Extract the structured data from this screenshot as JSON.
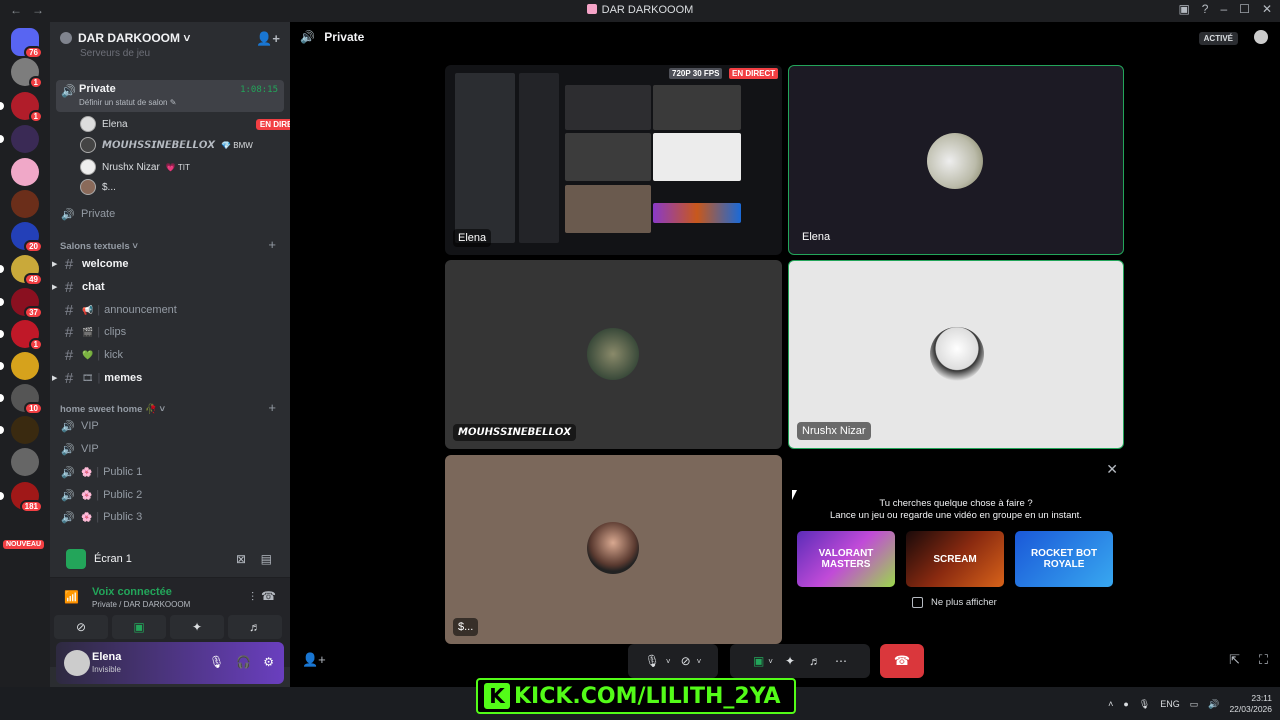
{
  "window": {
    "title": "DAR DARKOOOM",
    "back": "←",
    "forward": "→"
  },
  "servers": {
    "badges": [
      "76",
      "1",
      "1",
      "1",
      "1",
      "49",
      "37",
      "1",
      "10",
      "181",
      "20"
    ],
    "nouveau": "NOUVEAU"
  },
  "guild": {
    "name": "DAR DARKOOOM ˅",
    "faded_channel": "Serveurs de jeu"
  },
  "channels": {
    "private_active": {
      "name": "Private",
      "status": "Définir un statut de salon ✎",
      "timer": "1:08:15"
    },
    "voice_users": [
      {
        "name": "Elena",
        "tag": "EN DIRECT"
      },
      {
        "name": "𝙈𝙊𝙐𝙃𝙎𝙎𝙄𝙉𝙀𝘽𝙀𝙇𝙇𝙊𝙓",
        "tag": "💎 BMW"
      },
      {
        "name": "Nrushx Nizar",
        "tag": "💗 TIT"
      },
      {
        "name": "$...",
        "tag": ""
      }
    ],
    "private2": "Private",
    "cat_text": "Salons textuels ˅",
    "text": [
      {
        "name": "welcome"
      },
      {
        "name": "chat"
      },
      {
        "name": "announcement",
        "emoji": "📢"
      },
      {
        "name": "clips",
        "emoji": "🎬"
      },
      {
        "name": "kick",
        "emoji": "💚"
      },
      {
        "name": "memes",
        "emoji": "🎞"
      }
    ],
    "cat_home": "home sweet home 🥀 ˅",
    "voice": [
      {
        "name": "VIP"
      },
      {
        "name": "VIP"
      },
      {
        "name": "Public 1"
      },
      {
        "name": "Public 2"
      },
      {
        "name": "Public 3"
      }
    ]
  },
  "screen_share": {
    "label": "Écran 1"
  },
  "voice_panel": {
    "status": "Voix connectée",
    "location": "Private / DAR DARKOOOM"
  },
  "user": {
    "name": "Elena",
    "status": "Invisible"
  },
  "main": {
    "channel": "Private",
    "active_badge": "ACTIVÉ",
    "tiles": [
      {
        "name": "Elena",
        "quality": "720P 30 FPS",
        "live": "EN DIRECT"
      },
      {
        "name": "Elena"
      },
      {
        "name": "𝙈𝙊𝙐𝙃𝙎𝙎𝙄𝙉𝙀𝘽𝙀𝙇𝙇𝙊𝙓"
      },
      {
        "name": "Nrushx Nizar"
      },
      {
        "name": "$..."
      }
    ],
    "suggest": {
      "line1": "Tu cherches quelque chose à faire ?",
      "line2": "Lance un jeu ou regarde une vidéo en groupe en un instant.",
      "games": [
        "VALORANT MASTERS",
        "SCREAM",
        "ROCKET BOT ROYALE"
      ],
      "dont_show": "Ne plus afficher"
    }
  },
  "overlay": {
    "kick": "KICK.COM/LILITH_2YA"
  },
  "taskbar": {
    "lang": "ENG",
    "time": "23:11",
    "date": "22/03/2026"
  },
  "colors": {
    "accent_green": "#23a55a",
    "live_red": "#f23f43",
    "kick_green": "#53fc18"
  }
}
